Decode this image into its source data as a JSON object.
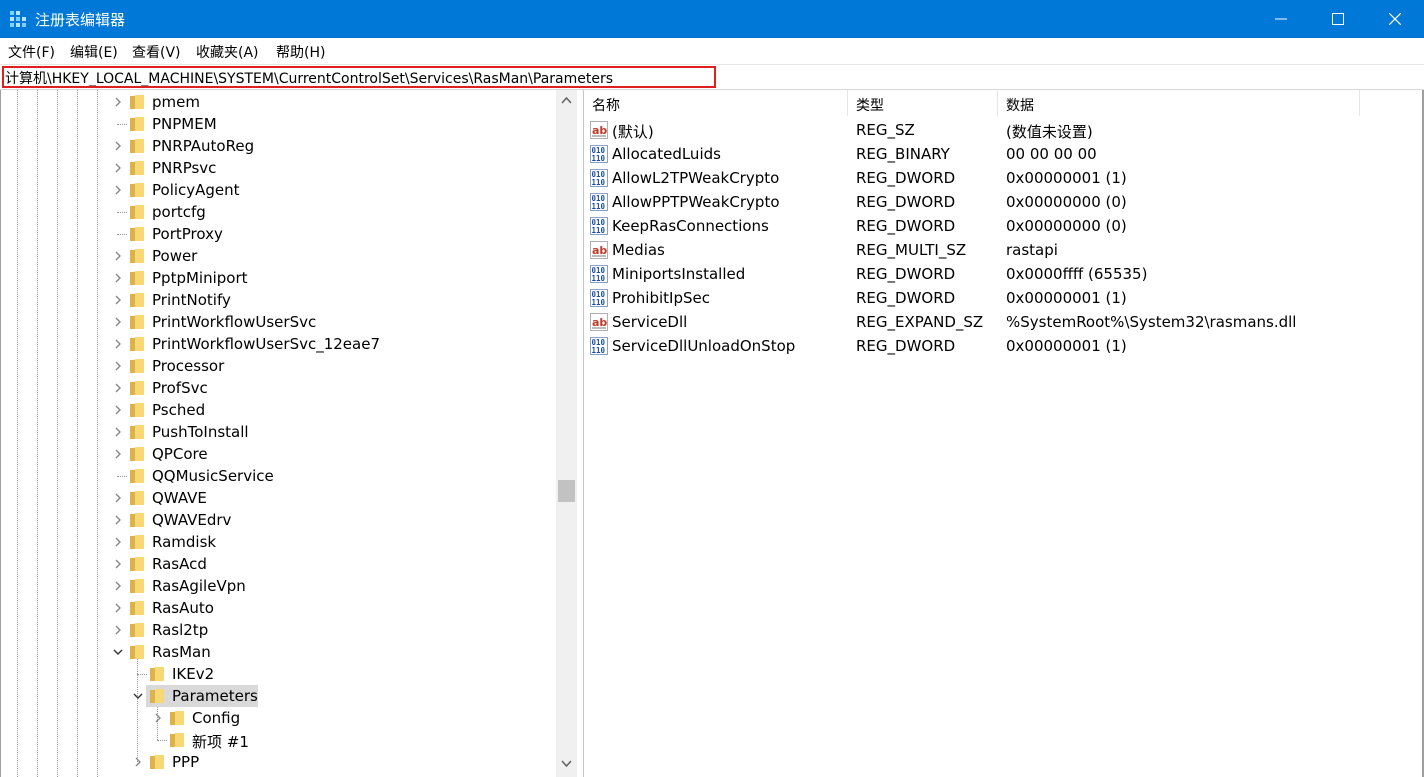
{
  "window": {
    "title": "注册表编辑器",
    "accent": "#0078d7"
  },
  "menu": [
    {
      "label": "文件(F)"
    },
    {
      "label": "编辑(E)"
    },
    {
      "label": "查看(V)"
    },
    {
      "label": "收藏夹(A)"
    },
    {
      "label": "帮助(H)"
    }
  ],
  "address": {
    "path": "计算机\\HKEY_LOCAL_MACHINE\\SYSTEM\\CurrentControlSet\\Services\\RasMan\\Parameters",
    "highlight_color": "#e02020"
  },
  "tree": {
    "items": [
      {
        "label": "pmem",
        "expander": "collapsed",
        "depth": 0
      },
      {
        "label": "PNPMEM",
        "expander": "none",
        "depth": 0
      },
      {
        "label": "PNRPAutoReg",
        "expander": "collapsed",
        "depth": 0
      },
      {
        "label": "PNRPsvc",
        "expander": "collapsed",
        "depth": 0
      },
      {
        "label": "PolicyAgent",
        "expander": "collapsed",
        "depth": 0
      },
      {
        "label": "portcfg",
        "expander": "none",
        "depth": 0
      },
      {
        "label": "PortProxy",
        "expander": "none",
        "depth": 0
      },
      {
        "label": "Power",
        "expander": "collapsed",
        "depth": 0
      },
      {
        "label": "PptpMiniport",
        "expander": "collapsed",
        "depth": 0
      },
      {
        "label": "PrintNotify",
        "expander": "collapsed",
        "depth": 0
      },
      {
        "label": "PrintWorkflowUserSvc",
        "expander": "collapsed",
        "depth": 0
      },
      {
        "label": "PrintWorkflowUserSvc_12eae7",
        "expander": "collapsed",
        "depth": 0
      },
      {
        "label": "Processor",
        "expander": "collapsed",
        "depth": 0
      },
      {
        "label": "ProfSvc",
        "expander": "collapsed",
        "depth": 0
      },
      {
        "label": "Psched",
        "expander": "collapsed",
        "depth": 0
      },
      {
        "label": "PushToInstall",
        "expander": "collapsed",
        "depth": 0
      },
      {
        "label": "QPCore",
        "expander": "collapsed",
        "depth": 0
      },
      {
        "label": "QQMusicService",
        "expander": "none",
        "depth": 0
      },
      {
        "label": "QWAVE",
        "expander": "collapsed",
        "depth": 0
      },
      {
        "label": "QWAVEdrv",
        "expander": "collapsed",
        "depth": 0
      },
      {
        "label": "Ramdisk",
        "expander": "collapsed",
        "depth": 0
      },
      {
        "label": "RasAcd",
        "expander": "collapsed",
        "depth": 0
      },
      {
        "label": "RasAgileVpn",
        "expander": "collapsed",
        "depth": 0
      },
      {
        "label": "RasAuto",
        "expander": "collapsed",
        "depth": 0
      },
      {
        "label": "Rasl2tp",
        "expander": "collapsed",
        "depth": 0
      },
      {
        "label": "RasMan",
        "expander": "expanded",
        "depth": 0
      },
      {
        "label": "IKEv2",
        "expander": "none",
        "depth": 1
      },
      {
        "label": "Parameters",
        "expander": "expanded",
        "depth": 1,
        "selected": true
      },
      {
        "label": "Config",
        "expander": "collapsed",
        "depth": 2
      },
      {
        "label": "新项 #1",
        "expander": "none",
        "depth": 2
      },
      {
        "label": "PPP",
        "expander": "collapsed",
        "depth": 1
      }
    ]
  },
  "values": {
    "columns": {
      "name": "名称",
      "type": "类型",
      "data": "数据"
    },
    "rows": [
      {
        "name": "(默认)",
        "type": "REG_SZ",
        "data": "(数值未设置)",
        "icon": "string-value-icon"
      },
      {
        "name": "AllocatedLuids",
        "type": "REG_BINARY",
        "data": "00 00 00 00",
        "icon": "binary-value-icon"
      },
      {
        "name": "AllowL2TPWeakCrypto",
        "type": "REG_DWORD",
        "data": "0x00000001 (1)",
        "icon": "binary-value-icon"
      },
      {
        "name": "AllowPPTPWeakCrypto",
        "type": "REG_DWORD",
        "data": "0x00000000 (0)",
        "icon": "binary-value-icon"
      },
      {
        "name": "KeepRasConnections",
        "type": "REG_DWORD",
        "data": "0x00000000 (0)",
        "icon": "binary-value-icon"
      },
      {
        "name": "Medias",
        "type": "REG_MULTI_SZ",
        "data": "rastapi",
        "icon": "string-value-icon"
      },
      {
        "name": "MiniportsInstalled",
        "type": "REG_DWORD",
        "data": "0x0000ffff (65535)",
        "icon": "binary-value-icon"
      },
      {
        "name": "ProhibitIpSec",
        "type": "REG_DWORD",
        "data": "0x00000001 (1)",
        "icon": "binary-value-icon"
      },
      {
        "name": "ServiceDll",
        "type": "REG_EXPAND_SZ",
        "data": "%SystemRoot%\\System32\\rasmans.dll",
        "icon": "string-value-icon"
      },
      {
        "name": "ServiceDllUnloadOnStop",
        "type": "REG_DWORD",
        "data": "0x00000001 (1)",
        "icon": "binary-value-icon"
      }
    ]
  }
}
